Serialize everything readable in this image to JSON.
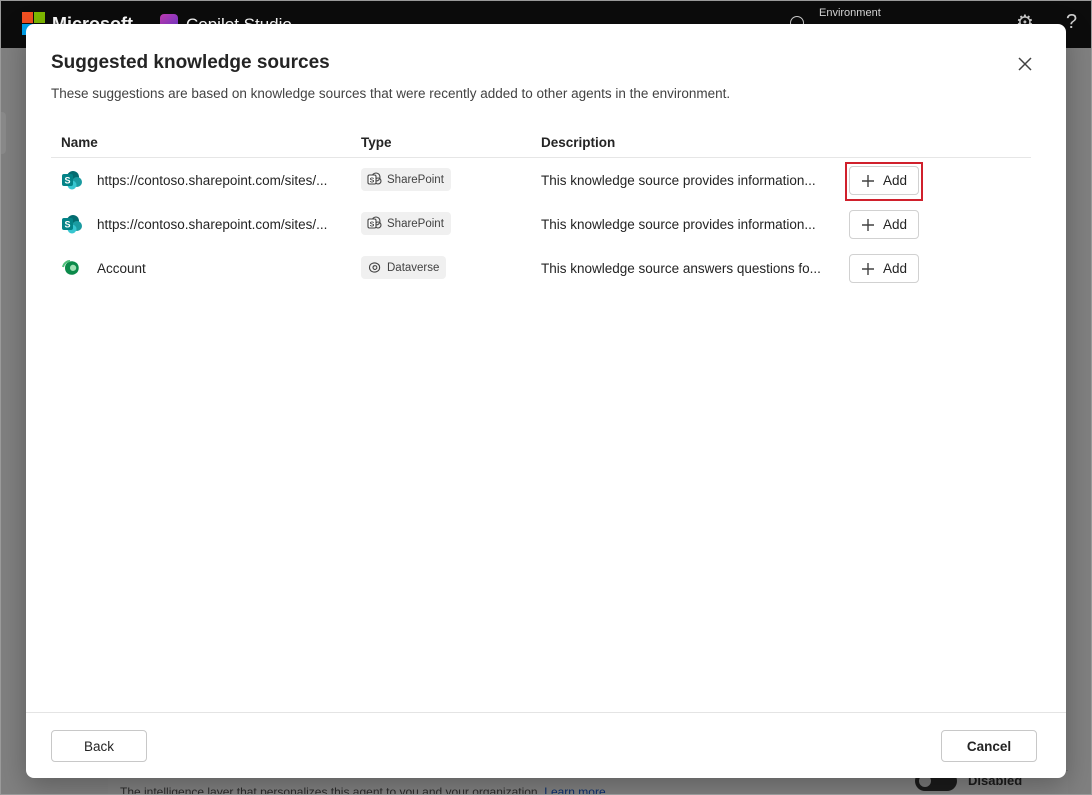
{
  "app": {
    "brand": "Microsoft",
    "product": "Copilot Studio",
    "environment_label": "Environment"
  },
  "background": {
    "settings_description": "The intelligence layer that personalizes this agent to you and your organization.",
    "learn_more": "Learn more",
    "toggle_label": "Disabled"
  },
  "dialog": {
    "title": "Suggested knowledge sources",
    "subtitle": "These suggestions are based on knowledge sources that were recently added to other agents in the environment.",
    "columns": {
      "name": "Name",
      "type": "Type",
      "description": "Description"
    },
    "rows": [
      {
        "name": "https://contoso.sharepoint.com/sites/...",
        "type": "SharePoint",
        "icon": "sharepoint-icon",
        "description": "This knowledge source provides information...",
        "action": "Add"
      },
      {
        "name": "https://contoso.sharepoint.com/sites/...",
        "type": "SharePoint",
        "icon": "sharepoint-icon",
        "description": "This knowledge source provides information...",
        "action": "Add"
      },
      {
        "name": "Account",
        "type": "Dataverse",
        "icon": "dataverse-icon",
        "description": "This knowledge source answers questions fo...",
        "action": "Add"
      }
    ],
    "back_label": "Back",
    "cancel_label": "Cancel"
  },
  "colors": {
    "highlight": "#d0202c",
    "sharepoint": "#038387",
    "dataverse": "#0b8a4a"
  }
}
